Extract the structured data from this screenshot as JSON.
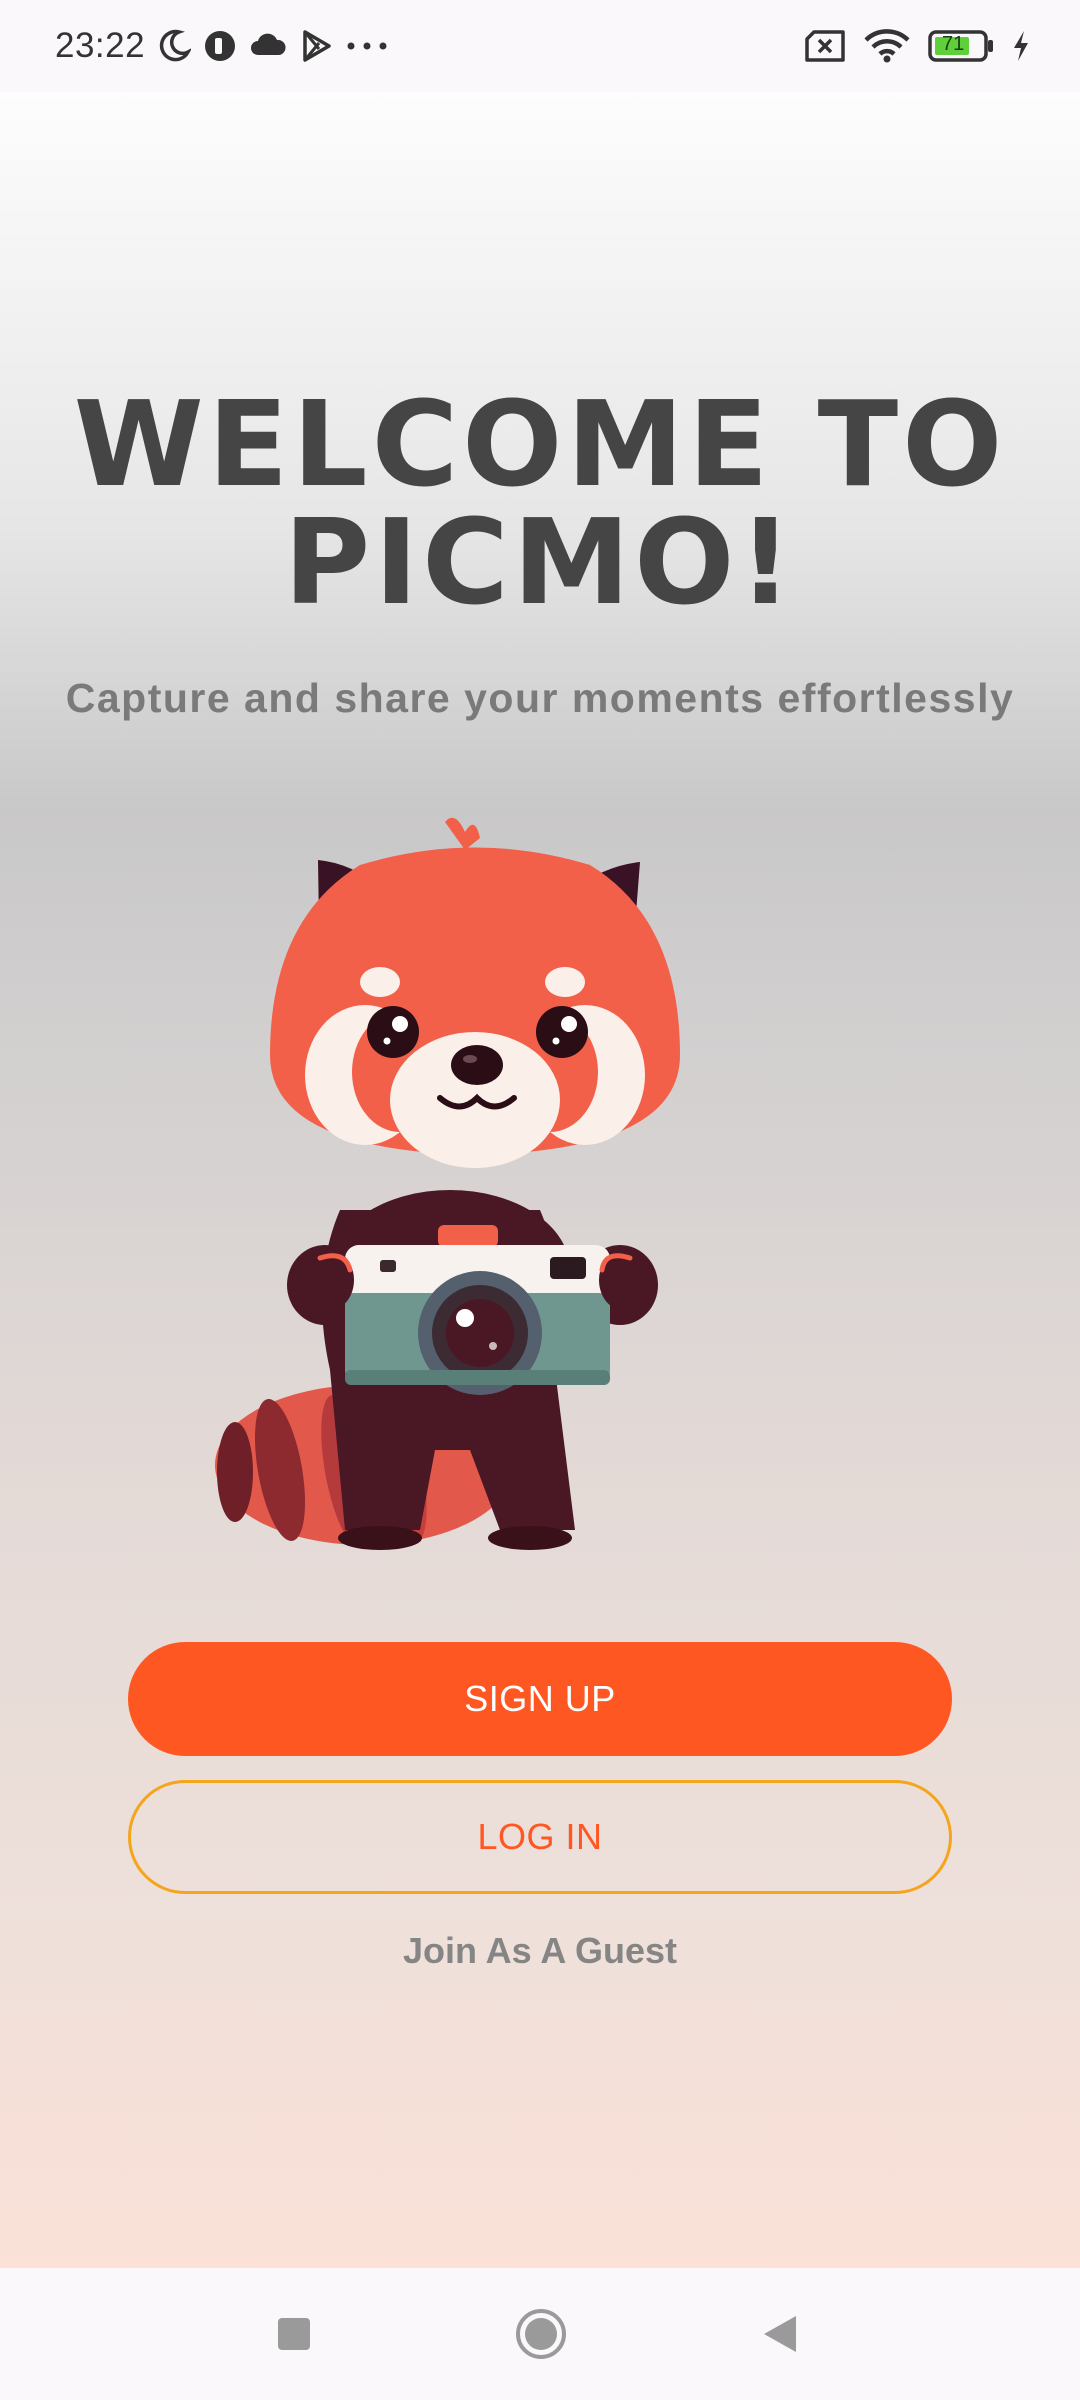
{
  "status_bar": {
    "time": "23:22",
    "battery_level": "71",
    "icons": [
      "moon-icon",
      "app-notification-icon",
      "cloud-icon",
      "play-store-icon",
      "more-dots-icon",
      "no-sim-icon",
      "wifi-icon",
      "battery-icon",
      "charging-icon"
    ]
  },
  "welcome": {
    "title_line1": "Welcome to",
    "title_line2": "Picmo!",
    "subtitle": "Capture and share your moments effortlessly"
  },
  "actions": {
    "signup_label": "SIGN UP",
    "login_label": "LOG IN",
    "guest_label": "Join As A Guest"
  },
  "nav_bar": {
    "icons": [
      "recents-square-icon",
      "home-circle-icon",
      "back-triangle-icon"
    ]
  },
  "colors": {
    "accent": "#ff5722",
    "login_border": "#f4a51c",
    "title": "#454545",
    "subtitle": "#7a7a7a"
  }
}
